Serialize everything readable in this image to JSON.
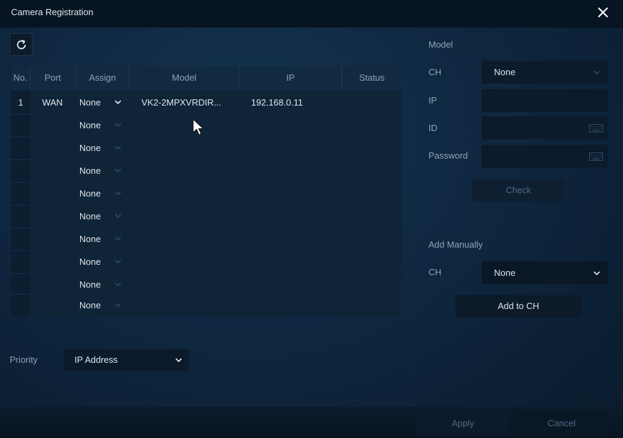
{
  "window": {
    "title": "Camera Registration",
    "close_icon": "close-icon"
  },
  "toolbar": {
    "refresh_icon": "refresh-icon"
  },
  "table": {
    "headers": [
      "No.",
      "Port",
      "Assign",
      "Model",
      "IP",
      "Status"
    ],
    "rows": [
      {
        "no": "1",
        "port": "WAN",
        "assign": "None",
        "model": "VK2-2MPXVRDIR...",
        "ip": "192.168.0.11",
        "status": ""
      },
      {
        "no": "",
        "port": "",
        "assign": "None",
        "model": "",
        "ip": "",
        "status": ""
      },
      {
        "no": "",
        "port": "",
        "assign": "None",
        "model": "",
        "ip": "",
        "status": ""
      },
      {
        "no": "",
        "port": "",
        "assign": "None",
        "model": "",
        "ip": "",
        "status": ""
      },
      {
        "no": "",
        "port": "",
        "assign": "None",
        "model": "",
        "ip": "",
        "status": ""
      },
      {
        "no": "",
        "port": "",
        "assign": "None",
        "model": "",
        "ip": "",
        "status": ""
      },
      {
        "no": "",
        "port": "",
        "assign": "None",
        "model": "",
        "ip": "",
        "status": ""
      },
      {
        "no": "",
        "port": "",
        "assign": "None",
        "model": "",
        "ip": "",
        "status": ""
      },
      {
        "no": "",
        "port": "",
        "assign": "None",
        "model": "",
        "ip": "",
        "status": ""
      },
      {
        "no": "",
        "port": "",
        "assign": "None",
        "model": "",
        "ip": "",
        "status": ""
      }
    ]
  },
  "priority": {
    "label": "Priority",
    "value": "IP Address"
  },
  "model_panel": {
    "title": "Model",
    "ch_label": "CH",
    "ch_value": "None",
    "ip_label": "IP",
    "ip_value": "",
    "id_label": "ID",
    "id_value": "",
    "password_label": "Password",
    "password_value": "",
    "check_label": "Check"
  },
  "add_manually": {
    "title": "Add Manually",
    "ch_label": "CH",
    "ch_value": "None",
    "add_label": "Add to CH"
  },
  "footer": {
    "apply_label": "Apply",
    "cancel_label": "Cancel"
  },
  "colors": {
    "background": "#0f2740",
    "titlebar": "#071422",
    "text": "#dfe6ed",
    "muted_text": "#8ea3b7"
  }
}
